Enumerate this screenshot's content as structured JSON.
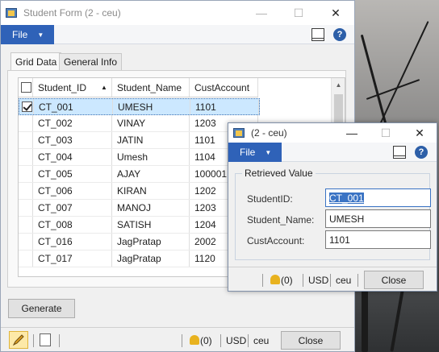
{
  "main_window": {
    "title": "Student Form (2 - ceu)",
    "file_label": "File",
    "tabs": [
      {
        "label": "Grid Data"
      },
      {
        "label": "General Info"
      }
    ],
    "grid": {
      "columns": [
        "Student_ID",
        "Student_Name",
        "CustAccount"
      ],
      "rows": [
        {
          "id": "CT_001",
          "name": "UMESH",
          "cust": "1101",
          "selected": true
        },
        {
          "id": "CT_002",
          "name": "VINAY",
          "cust": "1203"
        },
        {
          "id": "CT_003",
          "name": "JATIN",
          "cust": "1101"
        },
        {
          "id": "CT_004",
          "name": "Umesh",
          "cust": "1104"
        },
        {
          "id": "CT_005",
          "name": "AJAY",
          "cust": "100001"
        },
        {
          "id": "CT_006",
          "name": "KIRAN",
          "cust": "1202"
        },
        {
          "id": "CT_007",
          "name": "MANOJ",
          "cust": "1203"
        },
        {
          "id": "CT_008",
          "name": "SATISH",
          "cust": "1204"
        },
        {
          "id": "CT_016",
          "name": "JagPratap",
          "cust": "2002"
        },
        {
          "id": "CT_017",
          "name": "JagPratap",
          "cust": "1120"
        }
      ]
    },
    "generate_label": "Generate",
    "status": {
      "notifications": "(0)",
      "currency": "USD",
      "company": "ceu",
      "close_label": "Close"
    }
  },
  "dialog": {
    "title": "(2 - ceu)",
    "file_label": "File",
    "group_title": "Retrieved Value",
    "fields": [
      {
        "label": "StudentID:",
        "value": "CT_001"
      },
      {
        "label": "Student_Name:",
        "value": "UMESH"
      },
      {
        "label": "CustAccount:",
        "value": "1101"
      }
    ],
    "status": {
      "notifications": "(0)",
      "currency": "USD",
      "company": "ceu",
      "close_label": "Close"
    }
  },
  "icons": {
    "minimize": "minimize-icon",
    "maximize": "maximize-icon",
    "close": "close-icon",
    "help": "help-icon",
    "bell": "bell-icon",
    "pencil": "edit-pencil-icon"
  },
  "colors": {
    "file_button": "#2f62b8",
    "selected_row": "#cce8ff",
    "highlight": "#3a73c4"
  }
}
